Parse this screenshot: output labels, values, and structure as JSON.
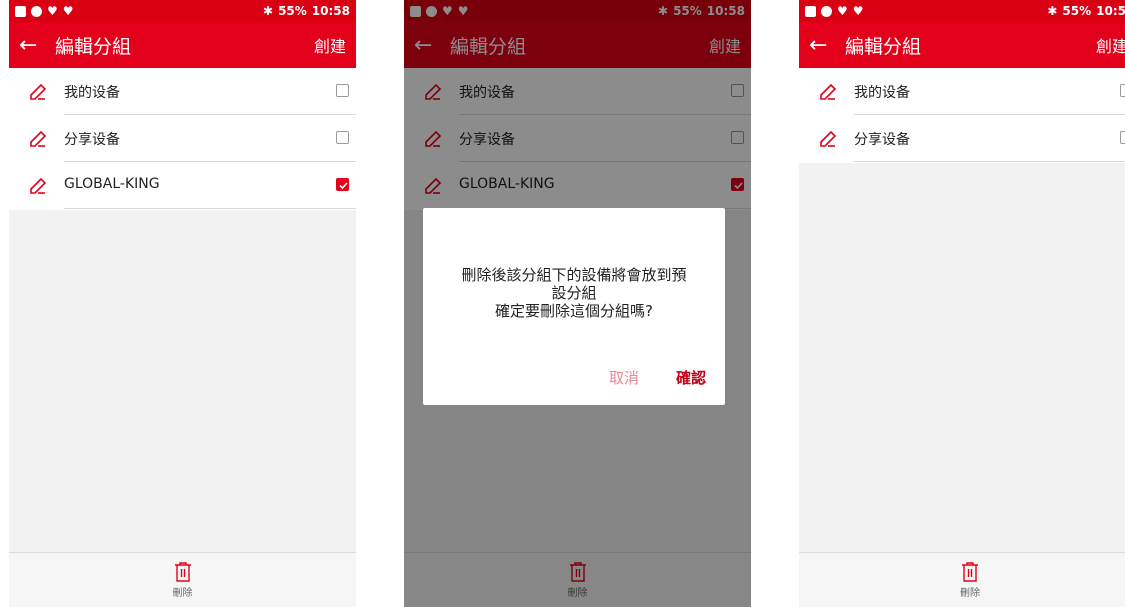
{
  "status_bar": {
    "battery": "55%",
    "time_full": "10:58",
    "time_clipped": "10:5"
  },
  "toolbar": {
    "title": "編輯分組",
    "action": "創建",
    "action_clipped": "創建"
  },
  "groups": [
    {
      "name": "我的设备",
      "checked": false
    },
    {
      "name": "分享设备",
      "checked": false
    },
    {
      "name": "GLOBAL-KING",
      "checked": true
    }
  ],
  "bottom": {
    "delete_label": "刪除"
  },
  "dialog": {
    "message": "刪除後該分組下的設備將會放到預\n設分組\n確定要刪除這個分組嗎?",
    "cancel": "取消",
    "confirm": "確認"
  },
  "colors": {
    "brand": "#e3001b",
    "status_bar": "#d90014",
    "cancel_text": "#e98595",
    "confirm_text": "#c1001a"
  },
  "icons": [
    "back-arrow-icon",
    "edit-icon",
    "checkbox-icon",
    "trash-icon"
  ]
}
